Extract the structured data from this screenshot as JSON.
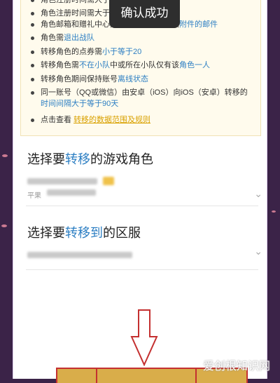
{
  "toast": {
    "text": "确认成功"
  },
  "rules": [
    {
      "parts": [
        {
          "t": "角色注册时间需大于等于",
          "c": ""
        },
        {
          "t": "...",
          "c": ""
        }
      ]
    },
    {
      "parts": [
        {
          "t": "角色邮箱和赠礼中心内，不可存在未领取",
          "c": ""
        },
        {
          "t": "附件的邮件",
          "c": "hl"
        }
      ]
    },
    {
      "parts": [
        {
          "t": "角色需",
          "c": ""
        },
        {
          "t": "退出战队",
          "c": "hl"
        }
      ]
    },
    {
      "parts": [
        {
          "t": "转移角色的点券需",
          "c": ""
        },
        {
          "t": "小于等于20",
          "c": "hl"
        }
      ]
    },
    {
      "parts": [
        {
          "t": "转移角色需",
          "c": ""
        },
        {
          "t": "不在小队",
          "c": "hl"
        },
        {
          "t": "中或所在小队仅有该",
          "c": ""
        },
        {
          "t": "角色一人",
          "c": "hl"
        }
      ]
    },
    {
      "parts": [
        {
          "t": "转移角色期间保持账号",
          "c": ""
        },
        {
          "t": "离线状态",
          "c": "hl"
        }
      ]
    },
    {
      "parts": [
        {
          "t": "同一账号（QQ或微信）由安卓（iOS）向iOS（安卓）转移的",
          "c": ""
        },
        {
          "t": "时间间隔大于等于90天",
          "c": "hl"
        }
      ]
    },
    {
      "parts": [
        {
          "t": "点击查看 ",
          "c": ""
        },
        {
          "t": "转移的数据范围及规则",
          "c": "lnk"
        }
      ]
    }
  ],
  "sections": {
    "choose_role_title": {
      "pre": "选择要",
      "hl": "转移",
      "post": "的游戏角色"
    },
    "choose_role_sub": "平果",
    "choose_server_title": {
      "pre": "选择要",
      "hl": "转移到",
      "post": "的区服"
    }
  },
  "watermark": "爱创根知识网",
  "colors": {
    "accent": "#2d7fc3",
    "link": "#d9a100",
    "background": "#3b2348",
    "arrow": "#c43030"
  }
}
